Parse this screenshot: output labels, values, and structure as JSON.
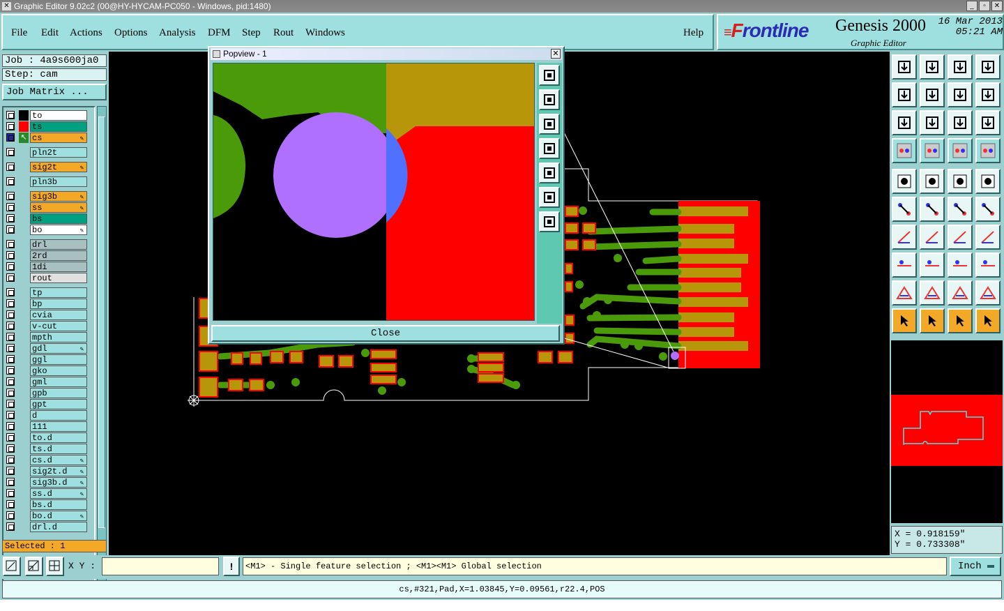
{
  "window": {
    "title": "Graphic Editor 9.02c2 (00@HY-HYCAM-PC050 - Windows, pid:1480)"
  },
  "menu": [
    "File",
    "Edit",
    "Actions",
    "Options",
    "Analysis",
    "DFM",
    "Step",
    "Rout",
    "Windows"
  ],
  "help_label": "Help",
  "brand": {
    "logo_f": "F",
    "logo_rest": "rontline",
    "product": "Genesis 2000",
    "subtitle": "Graphic Editor",
    "date": "16 Mar 2013",
    "time": "05:21 AM"
  },
  "job": {
    "job_label": "Job : 4a9s600ja0",
    "step_label": "Step: cam",
    "matrix_button": "Job Matrix ..."
  },
  "layers": [
    {
      "name": "to",
      "color": "#ffffff",
      "swatch": "#000000",
      "edit": false
    },
    {
      "name": "ts",
      "color": "#00a080",
      "swatch": "#ff0000",
      "edit": false
    },
    {
      "name": "cs",
      "color": "#f4a828",
      "swatch": "#2a8a2a",
      "edit": true,
      "work": true
    },
    {
      "name": "pln2t",
      "color": "#9ee0e0",
      "swatch": "",
      "edit": false
    },
    {
      "name": "sig2t",
      "color": "#f4a828",
      "swatch": "",
      "edit": true
    },
    {
      "name": "pln3b",
      "color": "#9ee0e0",
      "swatch": "",
      "edit": false
    },
    {
      "name": "sig3b",
      "color": "#f4a828",
      "swatch": "",
      "edit": true
    },
    {
      "name": "ss",
      "color": "#f4a828",
      "swatch": "",
      "edit": true
    },
    {
      "name": "bs",
      "color": "#00a080",
      "swatch": "",
      "edit": false
    },
    {
      "name": "bo",
      "color": "#ffffff",
      "swatch": "",
      "edit": true
    },
    {
      "name": "drl",
      "color": "#a8c0c0",
      "swatch": "",
      "edit": false
    },
    {
      "name": "2rd",
      "color": "#a8c0c0",
      "swatch": "",
      "edit": false
    },
    {
      "name": "1di",
      "color": "#a8c0c0",
      "swatch": "",
      "edit": false
    },
    {
      "name": "rout",
      "color": "#e0e0e0",
      "swatch": "",
      "edit": false
    },
    {
      "name": "tp",
      "color": "#9ee0e0",
      "swatch": "",
      "edit": false
    },
    {
      "name": "bp",
      "color": "#9ee0e0",
      "swatch": "",
      "edit": false
    },
    {
      "name": "cvia",
      "color": "#9ee0e0",
      "swatch": "",
      "edit": false
    },
    {
      "name": "v-cut",
      "color": "#9ee0e0",
      "swatch": "",
      "edit": false
    },
    {
      "name": "mpth",
      "color": "#9ee0e0",
      "swatch": "",
      "edit": false
    },
    {
      "name": "gdl",
      "color": "#9ee0e0",
      "swatch": "",
      "edit": true
    },
    {
      "name": "ggl",
      "color": "#9ee0e0",
      "swatch": "",
      "edit": false
    },
    {
      "name": "gko",
      "color": "#9ee0e0",
      "swatch": "",
      "edit": false
    },
    {
      "name": "gml",
      "color": "#9ee0e0",
      "swatch": "",
      "edit": false
    },
    {
      "name": "gpb",
      "color": "#9ee0e0",
      "swatch": "",
      "edit": false
    },
    {
      "name": "gpt",
      "color": "#9ee0e0",
      "swatch": "",
      "edit": false
    },
    {
      "name": "d",
      "color": "#9ee0e0",
      "swatch": "",
      "edit": false
    },
    {
      "name": "111",
      "color": "#9ee0e0",
      "swatch": "",
      "edit": false
    },
    {
      "name": "to.d",
      "color": "#9ee0e0",
      "swatch": "",
      "edit": false
    },
    {
      "name": "ts.d",
      "color": "#9ee0e0",
      "swatch": "",
      "edit": false
    },
    {
      "name": "cs.d",
      "color": "#9ee0e0",
      "swatch": "",
      "edit": true
    },
    {
      "name": "sig2t.d",
      "color": "#9ee0e0",
      "swatch": "",
      "edit": true
    },
    {
      "name": "sig3b.d",
      "color": "#9ee0e0",
      "swatch": "",
      "edit": true
    },
    {
      "name": "ss.d",
      "color": "#9ee0e0",
      "swatch": "",
      "edit": true
    },
    {
      "name": "bs.d",
      "color": "#9ee0e0",
      "swatch": "",
      "edit": false
    },
    {
      "name": "bo.d",
      "color": "#9ee0e0",
      "swatch": "",
      "edit": true
    },
    {
      "name": "drl.d",
      "color": "#9ee0e0",
      "swatch": "",
      "edit": false
    }
  ],
  "selected": "Selected : 1",
  "popview": {
    "title": "Popview - 1",
    "close_label": "Close"
  },
  "coords": {
    "x": "X = 0.918159\"",
    "y": "Y = 0.733308\""
  },
  "bottom": {
    "xy_label": "X Y :",
    "xy_value": "",
    "hint": "<M1> - Single feature selection ; <M1><M1> Global selection",
    "units": "Inch"
  },
  "status": "cs,#321,Pad,X=1.03845,Y=0.09561,r22.4,POS",
  "colors": {
    "copper": "#b8960a",
    "signal": "#4a9a0a",
    "solder": "#ff0000",
    "highlight": "#b070ff",
    "select": "#5070ff"
  }
}
